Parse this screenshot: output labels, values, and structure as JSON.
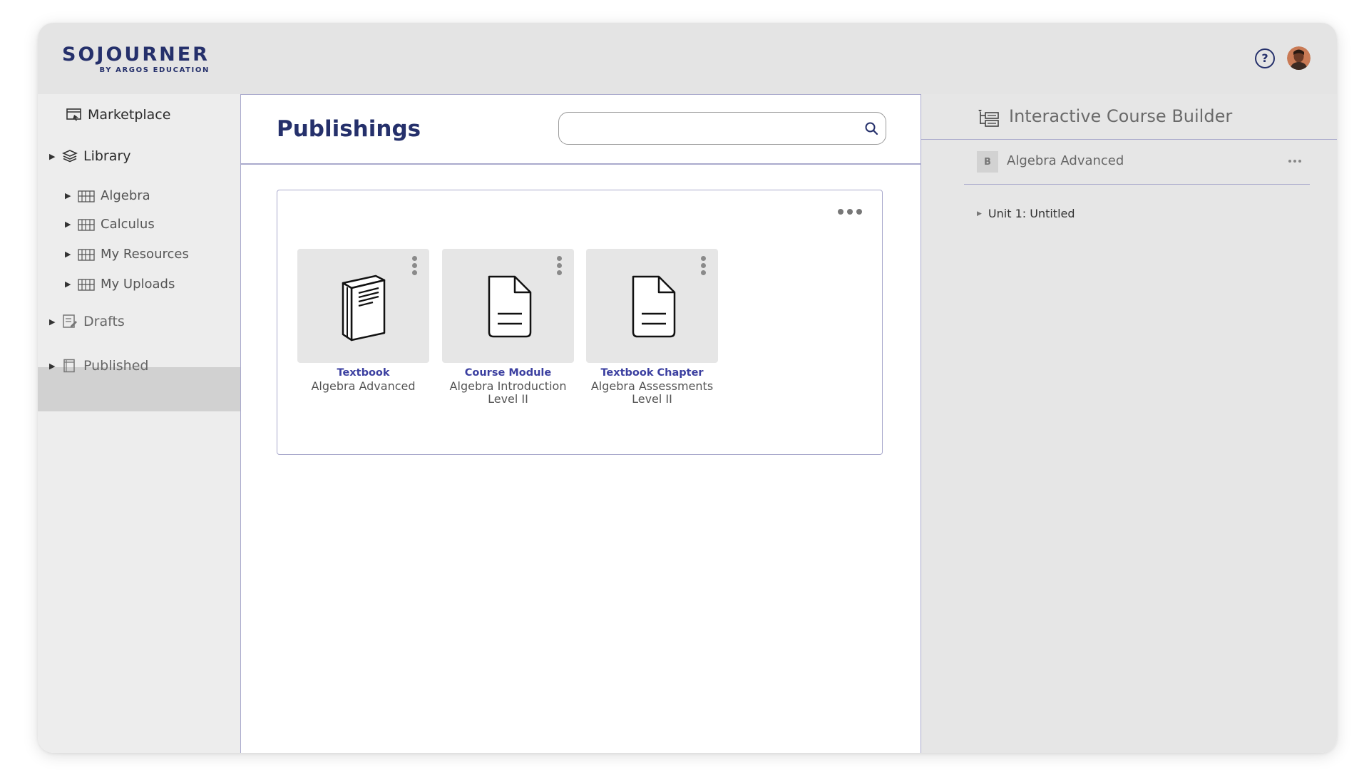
{
  "header": {
    "logo_main": "SOJOURNER",
    "logo_sub": "BY ARGOS EDUCATION",
    "help_icon": "?"
  },
  "sidebar": {
    "marketplace": "Marketplace",
    "library": "Library",
    "library_items": [
      "Algebra",
      "Calculus",
      "My Resources",
      "My Uploads"
    ],
    "drafts": "Drafts",
    "published": "Published"
  },
  "main": {
    "title": "Publishings",
    "search": {
      "value": "",
      "placeholder": ""
    },
    "tiles": [
      {
        "type": "Textbook",
        "name": "Algebra Advanced",
        "icon": "book-icon"
      },
      {
        "type": "Course Module",
        "name": "Algebra Introduction Level II",
        "icon": "document-icon"
      },
      {
        "type": "Textbook Chapter",
        "name": "Algebra Assessments Level II",
        "icon": "document-icon"
      }
    ]
  },
  "builder": {
    "title": "Interactive Course Builder",
    "course_badge": "B",
    "course_name": "Algebra Advanced",
    "unit": "Unit 1: Untitled"
  },
  "colors": {
    "brand": "#25306b",
    "accent_link": "#3b3fa0",
    "divider": "#a9a9cc",
    "header_bg": "#e4e4e4",
    "sidebar_bg": "#ededed",
    "selected_bg": "#d1d1d1"
  }
}
